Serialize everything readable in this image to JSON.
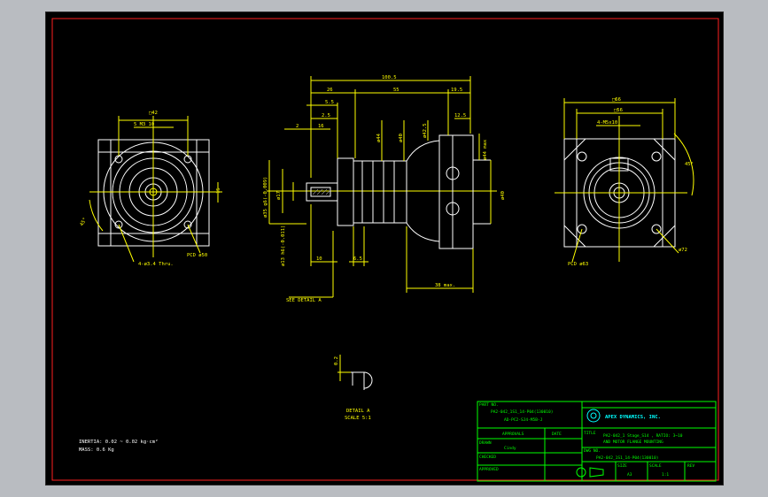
{
  "colors": {
    "background": "#b9bcc1",
    "sheet": "#000000",
    "border": "#ff2020",
    "dimension": "#ffff00",
    "geometry": "#ffffff",
    "titleblock": "#00ff00",
    "title_text": "#00ffff"
  },
  "left_view": {
    "square_dim": "□42",
    "thread_note": "5 M3 10",
    "side_dim": "15",
    "angle": "45°",
    "holes_note": "4-ø3.4 Thru.",
    "pcd_note": "PCD ø50"
  },
  "front_view": {
    "overall_length": "100.5",
    "d1": "26",
    "d2": "55",
    "d3": "19.5",
    "d4": "5.5",
    "d5": "2.5",
    "d6": "2",
    "d7": "16",
    "d8": "12.5",
    "dia1": "ø44",
    "dia2": "ø40",
    "dia3": "ø42.5",
    "dia4": "ø44 max",
    "dia5": "ø40",
    "shaft_note1": "ø35 g6(-0.009)",
    "shaft_note2": "ø17",
    "shaft_note3": "ø13 h6(-0.011)",
    "dim_len1": "10",
    "dim_len2": "6.5",
    "dim_len3": "38 max.",
    "see_detail": "SEE DETAIL A"
  },
  "right_view": {
    "square_dim": "□66",
    "inner_dim": "□56",
    "holes_note": "4-M5x10",
    "angle": "45°",
    "pcd_note": "PCD ø63",
    "dia": "ø72"
  },
  "detail": {
    "dim": "0.2",
    "label": "DETAIL A",
    "scale": "SCALE 5:1"
  },
  "notes": {
    "inertia": "INERTIA: 0.02 ~ 0.02 kg·cm²",
    "mass": "MASS: 0.6  Kg"
  },
  "title_block": {
    "part_no_label": "PART NO.",
    "part_no_1": "PA2-042_1S1_14-P04(130010)",
    "part_no_2": "AD-PC2-SJ4-M5B-J",
    "company": "APEX DYNAMICS, INC.",
    "approvals_label": "APPROVALS",
    "date_label": "DATE",
    "title_label": "TITLE",
    "title_1": "PA2-042_1 Stage_S14 , RATIO: 3~10",
    "title_2": "AND MOTOR FLANGE MOUNTING",
    "drawn_label": "DRAWN",
    "drawn_value": "Cindy",
    "checked_label": "CHECKED",
    "dwg_no_label": "DWG NO.",
    "dwg_no_value": "PA2-042_1S1_14-P04(130010)",
    "approved_label": "APPROVED",
    "size_label": "SIZE",
    "size_value": "A3",
    "scale_label": "SCALE",
    "scale_value": "1:1",
    "rev_label": "REV"
  }
}
